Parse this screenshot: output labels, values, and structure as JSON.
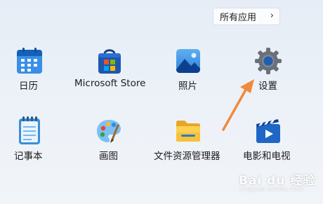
{
  "all_apps_button": {
    "label": "所有应用",
    "chevron": "›"
  },
  "apps": [
    {
      "label": "日历",
      "icon": "calendar-icon"
    },
    {
      "label": "Microsoft Store",
      "icon": "microsoft-store-icon"
    },
    {
      "label": "照片",
      "icon": "photos-icon"
    },
    {
      "label": "设置",
      "icon": "settings-gear-icon"
    },
    {
      "label": "记事本",
      "icon": "notepad-icon"
    },
    {
      "label": "画图",
      "icon": "paint-palette-icon"
    },
    {
      "label": "文件资源管理器",
      "icon": "file-explorer-folder-icon"
    },
    {
      "label": "电影和电视",
      "icon": "movies-tv-icon"
    }
  ],
  "annotation": {
    "arrow_color": "#f08a3c",
    "points_to": "设置"
  },
  "watermark": {
    "text": "Bai du 经验",
    "subtext": "jingyan.baidu.com"
  },
  "colors": {
    "accent": "#0f6cbd",
    "arrow": "#f08a3c"
  }
}
